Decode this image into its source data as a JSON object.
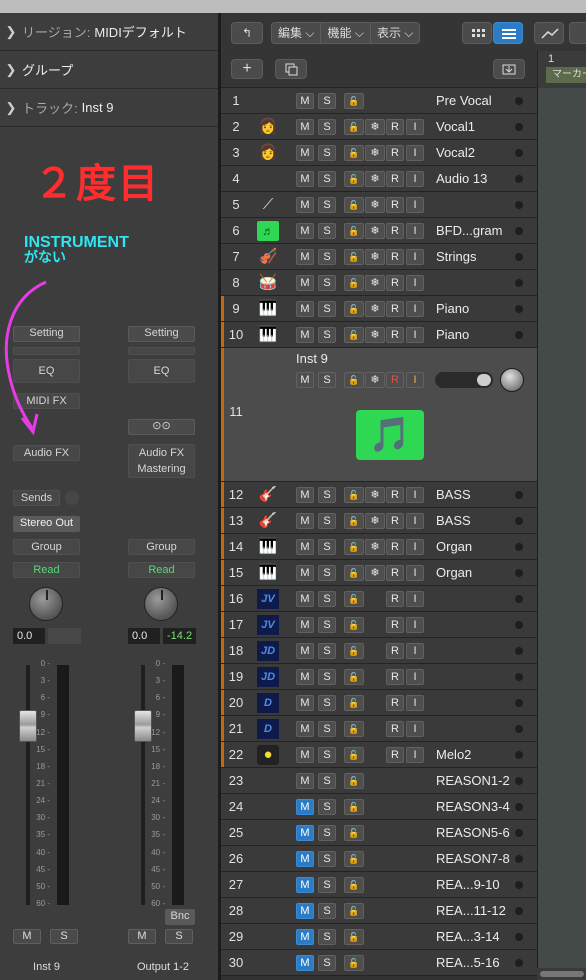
{
  "inspector": {
    "region_label": "リージョン:",
    "region_value": "MIDIデフォルト",
    "group_label": "グループ",
    "track_label": "トラック:",
    "track_value": "Inst 9"
  },
  "annotation": {
    "title": "２度目",
    "note_line1": "INSTRUMENT",
    "note_line2": "がない"
  },
  "strip1": {
    "setting": "Setting",
    "eq": "EQ",
    "midi_fx": "MIDI FX",
    "audio_fx": "Audio FX",
    "sends": "Sends",
    "output": "Stereo Out",
    "group": "Group",
    "automation": "Read",
    "volume": "0.0",
    "mute": "M",
    "solo": "S",
    "name": "Inst 9"
  },
  "strip2": {
    "setting": "Setting",
    "eq": "EQ",
    "link_icon": "link-icon",
    "audio_fx": "Audio FX",
    "mastering": "Mastering",
    "group": "Group",
    "automation": "Read",
    "volume": "0.0",
    "peak": "-14.2",
    "bounce": "Bnc",
    "mute": "M",
    "solo": "S",
    "name": "Output 1-2"
  },
  "fader_scale": [
    "0",
    "3",
    "6",
    "9",
    "12",
    "15",
    "18",
    "21",
    "24",
    "30",
    "35",
    "40",
    "45",
    "50",
    "60"
  ],
  "toolbar": {
    "back_icon": "back-arrow-icon",
    "menu_edit": "編集",
    "menu_function": "機能",
    "menu_view": "表示",
    "chevron": "⌵",
    "grid_icon": "grid-view-icon",
    "list_icon": "list-view-icon",
    "automation_icon": "automation-curve-icon",
    "add_track": "+",
    "duplicate_track": "duplicate-track-icon",
    "download_icon": "tray-icon"
  },
  "ruler": {
    "bar": "1",
    "marker": "マーカー"
  },
  "tracks": [
    {
      "num": "1",
      "name": "Pre Vocal",
      "icon": "",
      "color": "",
      "m_on": false,
      "has_freeze": false,
      "has_ri": false,
      "red_r": false
    },
    {
      "num": "2",
      "name": "Vocal1",
      "icon": "👩",
      "color": "",
      "m_on": false,
      "has_freeze": true,
      "has_ri": true
    },
    {
      "num": "3",
      "name": "Vocal2",
      "icon": "👩",
      "color": "",
      "m_on": false,
      "has_freeze": true,
      "has_ri": true
    },
    {
      "num": "4",
      "name": "Audio 13",
      "icon": "",
      "color": "",
      "m_on": false,
      "has_freeze": true,
      "has_ri": true
    },
    {
      "num": "5",
      "name": "",
      "icon": "⟋",
      "color": "",
      "m_on": false,
      "has_freeze": true,
      "has_ri": true
    },
    {
      "num": "6",
      "name": "BFD...gram",
      "icon": "♬",
      "color": "",
      "m_on": false,
      "has_freeze": true,
      "has_ri": true
    },
    {
      "num": "7",
      "name": "Strings",
      "icon": "🎻",
      "color": "",
      "m_on": false,
      "has_freeze": true,
      "has_ri": true
    },
    {
      "num": "8",
      "name": "",
      "icon": "🥁",
      "color": "",
      "m_on": false,
      "has_freeze": true,
      "has_ri": true
    },
    {
      "num": "9",
      "name": "Piano",
      "icon": "🎹",
      "color": "#c26a13",
      "m_on": false,
      "has_freeze": true,
      "has_ri": true
    },
    {
      "num": "10",
      "name": "Piano",
      "icon": "🎹",
      "color": "#c26a13",
      "m_on": false,
      "has_freeze": true,
      "has_ri": true
    },
    {
      "num": "11",
      "name": "Inst 9",
      "icon": "🎵",
      "color": "#c26a13",
      "m_on": false,
      "has_freeze": true,
      "has_ri": true,
      "big": true
    },
    {
      "num": "12",
      "name": "BASS",
      "icon": "🎸",
      "color": "#c26a13",
      "m_on": false,
      "has_freeze": true,
      "has_ri": true
    },
    {
      "num": "13",
      "name": "BASS",
      "icon": "🎸",
      "color": "#c26a13",
      "m_on": false,
      "has_freeze": true,
      "has_ri": true
    },
    {
      "num": "14",
      "name": "Organ",
      "icon": "🎹",
      "color": "#c26a13",
      "m_on": false,
      "has_freeze": true,
      "has_ri": true
    },
    {
      "num": "15",
      "name": "Organ",
      "icon": "🎹",
      "color": "#c26a13",
      "m_on": false,
      "has_freeze": true,
      "has_ri": true
    },
    {
      "num": "16",
      "name": "",
      "icon": "JV",
      "color": "#c26a13",
      "m_on": false,
      "has_freeze": false,
      "has_ri": true
    },
    {
      "num": "17",
      "name": "",
      "icon": "JV",
      "color": "#c26a13",
      "m_on": false,
      "has_freeze": false,
      "has_ri": true
    },
    {
      "num": "18",
      "name": "",
      "icon": "JD",
      "color": "#c26a13",
      "m_on": false,
      "has_freeze": false,
      "has_ri": true
    },
    {
      "num": "19",
      "name": "",
      "icon": "JD",
      "color": "#c26a13",
      "m_on": false,
      "has_freeze": false,
      "has_ri": true
    },
    {
      "num": "20",
      "name": "",
      "icon": "D",
      "color": "#c26a13",
      "m_on": false,
      "has_freeze": false,
      "has_ri": true
    },
    {
      "num": "21",
      "name": "",
      "icon": "D",
      "color": "#c26a13",
      "m_on": false,
      "has_freeze": false,
      "has_ri": true
    },
    {
      "num": "22",
      "name": "Melo2",
      "icon": "●",
      "color": "#c26a13",
      "m_on": false,
      "has_freeze": false,
      "has_ri": true
    },
    {
      "num": "23",
      "name": "REASON1-2",
      "icon": "",
      "color": "",
      "m_on": false,
      "has_freeze": false,
      "has_ri": false
    },
    {
      "num": "24",
      "name": "REASON3-4",
      "icon": "",
      "color": "",
      "m_on": true,
      "has_freeze": false,
      "has_ri": false
    },
    {
      "num": "25",
      "name": "REASON5-6",
      "icon": "",
      "color": "",
      "m_on": true,
      "has_freeze": false,
      "has_ri": false
    },
    {
      "num": "26",
      "name": "REASON7-8",
      "icon": "",
      "color": "",
      "m_on": true,
      "has_freeze": false,
      "has_ri": false
    },
    {
      "num": "27",
      "name": "REA...9-10",
      "icon": "",
      "color": "",
      "m_on": true,
      "has_freeze": false,
      "has_ri": false
    },
    {
      "num": "28",
      "name": "REA...11-12",
      "icon": "",
      "color": "",
      "m_on": true,
      "has_freeze": false,
      "has_ri": false
    },
    {
      "num": "29",
      "name": "REA...3-14",
      "icon": "",
      "color": "",
      "m_on": true,
      "has_freeze": false,
      "has_ri": false
    },
    {
      "num": "30",
      "name": "REA...5-16",
      "icon": "",
      "color": "",
      "m_on": true,
      "has_freeze": false,
      "has_ri": false
    }
  ],
  "track_button_labels": {
    "mute": "M",
    "solo": "S",
    "lock": "🔓",
    "freeze": "❄",
    "record": "R",
    "input": "I"
  },
  "colors": {
    "annotation_red": "#ff2d2d",
    "annotation_cyan": "#2ee6f2",
    "arrow_magenta": "#e63ce6",
    "mute_active": "#2c7cc5",
    "read_green": "#58d878",
    "instrument_green": "#2ed852",
    "track_orange": "#c26a13"
  }
}
